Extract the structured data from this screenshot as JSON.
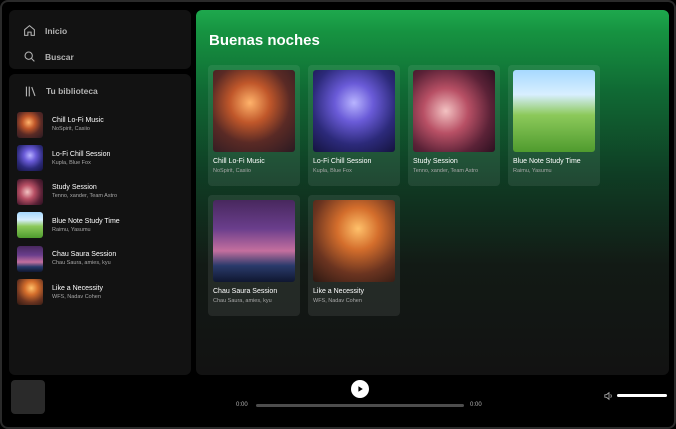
{
  "nav": {
    "home_label": "Inicio",
    "search_label": "Buscar"
  },
  "library": {
    "title": "Tu biblioteca",
    "items": [
      {
        "name": "Chill Lo-Fi Music",
        "artists": "NoSpirit, Casiio",
        "cover": "c-chill"
      },
      {
        "name": "Lo-Fi Chill Session",
        "artists": "Kupla, Blue Fox",
        "cover": "c-lofi"
      },
      {
        "name": "Study Session",
        "artists": "Tenno, xander, Team Astro",
        "cover": "c-study"
      },
      {
        "name": "Blue Note Study Time",
        "artists": "Raimu, Yasumu",
        "cover": "c-blue"
      },
      {
        "name": "Chau Saura Session",
        "artists": "Chau Saura, amies, kyu",
        "cover": "c-chau"
      },
      {
        "name": "Like a Necessity",
        "artists": "WFS, Nadav Cohen",
        "cover": "c-like"
      }
    ]
  },
  "main": {
    "heading": "Buenas noches",
    "cards": [
      {
        "name": "Chill Lo-Fi Music",
        "artists": "NoSpirit, Casiio",
        "cover": "c-chill"
      },
      {
        "name": "Lo-Fi Chill Session",
        "artists": "Kupla, Blue Fox",
        "cover": "c-lofi"
      },
      {
        "name": "Study Session",
        "artists": "Tenno, xander, Team Astro",
        "cover": "c-study"
      },
      {
        "name": "Blue Note Study Time",
        "artists": "Raimu, Yasumu",
        "cover": "c-blue"
      },
      {
        "name": "Chau Saura Session",
        "artists": "Chau Saura, amies, kyu",
        "cover": "c-chau"
      },
      {
        "name": "Like a Necessity",
        "artists": "WFS, Nadav Cohen",
        "cover": "c-like"
      }
    ]
  },
  "player": {
    "time_elapsed": "0:00",
    "time_total": "0:00",
    "progress_fraction": 0,
    "volume_fraction": 1
  },
  "colors": {
    "accent": "#1ea84d",
    "panel": "#121212"
  },
  "icons": {
    "home": "home-icon",
    "search": "search-icon",
    "library": "library-icon",
    "play": "play-icon",
    "volume": "volume-icon"
  }
}
